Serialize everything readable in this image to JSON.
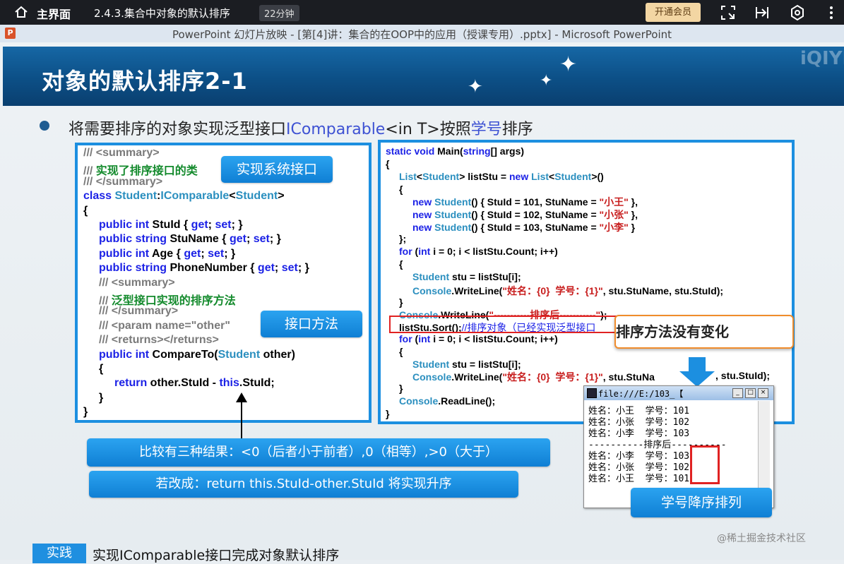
{
  "topbar": {
    "home_label": "主界面",
    "video_title": "2.4.3.集合中对象的默认排序",
    "duration": "22分钟",
    "vip_button": "开通会员"
  },
  "window": {
    "app_badge": "P",
    "title": "PowerPoint 幻灯片放映 - [第[4]讲：集合的在OOP中的应用（授课专用）.pptx] - Microsoft PowerPoint"
  },
  "slide": {
    "title": "对象的默认排序2-1",
    "watermark_logo": "iQIYI",
    "bullet": {
      "p1": "将需要排序的对象实现泛型接口",
      "p2": "IComparable",
      "p3": "<in T>按照",
      "p4": "学号",
      "p5": "排序"
    },
    "left_code": [
      "/// <summary>",
      "/// 实现了排序接口的类",
      "/// </summary>",
      "class Student:IComparable<Student>",
      "{",
      "public int StuId { get; set; }",
      "public string StuName { get; set; }",
      "public int Age { get; set; }",
      "public string PhoneNumber { get; set; }",
      "/// <summary>",
      "/// 泛型接口实现的排序方法",
      "/// </summary>",
      "/// <param name=\"other\"",
      "/// <returns></returns>",
      "public int CompareTo(Student other)",
      "{",
      "return other.StuId - this.StuId;",
      "}",
      "}"
    ],
    "right_code": [
      "static void Main(string[] args)",
      "{",
      "List<Student> listStu = new List<Student>()",
      "{",
      "new Student() { StuId = 101, StuName = \"小王\" },",
      "new Student() { StuId = 102, StuName = \"小张\" },",
      "new Student() { StuId = 103, StuName = \"小李\" }",
      "};",
      "for (int i = 0; i < listStu.Count; i++)",
      "{",
      "Student stu = listStu[i];",
      "Console.WriteLine(\"姓名：{0}  学号：{1}\", stu.StuName, stu.StuId);",
      "}",
      "Console.WriteLine(\"-----------排序后-----------\");",
      "listStu.Sort();//排序对象（已经实现泛型接口",
      "for (int i = 0; i < listStu.Count; i++)",
      "{",
      "Student stu = listStu[i];",
      "Console.WriteLine(\"姓名：{0}  学号：{1}\", stu.StuNa",
      "}",
      "Console.ReadLine();",
      "}"
    ],
    "right_code_tail": ", stu.StuId);",
    "callouts": {
      "implement_interface": "实现系统接口",
      "interface_method": "接口方法",
      "no_change": "排序方法没有变化",
      "compare_results": "比较有三种结果：<0（后者小于前者）,0（相等）,>0（大于）",
      "ascending": "若改成：return this.StuId-other.StuId 将实现升序",
      "descending": "学号降序排列"
    },
    "console": {
      "title": "file:///E:/103_【",
      "lines": [
        "姓名：小王  学号：101",
        "姓名：小张  学号：102",
        "姓名：小李  学号：103",
        "----------排序后----------",
        "姓名：小李  学号：103",
        "姓名：小张  学号：102",
        "姓名：小王  学号：101"
      ]
    },
    "practice_badge": "实践",
    "practice_text": "实现IComparable接口完成对象默认排序",
    "site_watermark": "@稀土掘金技术社区"
  }
}
